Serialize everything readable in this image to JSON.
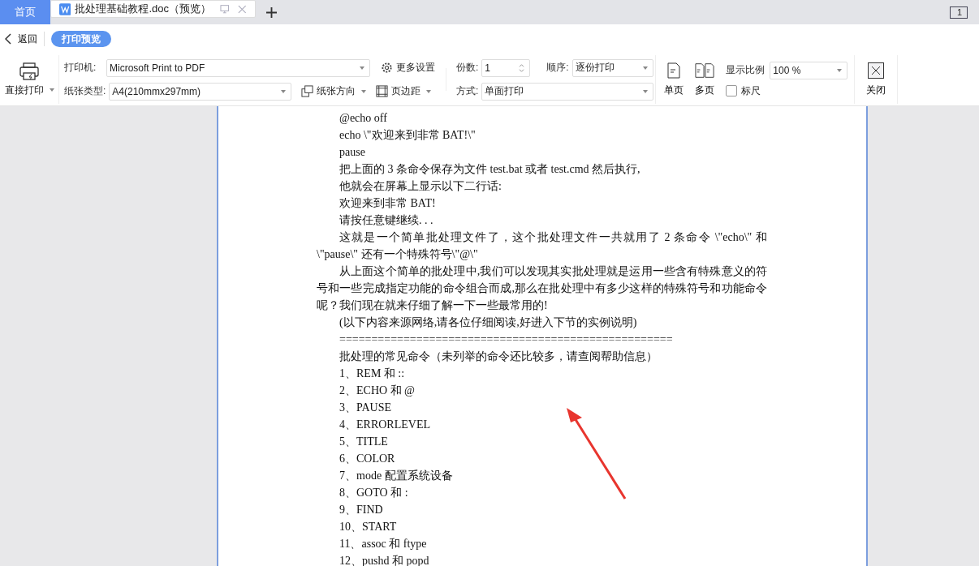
{
  "tabs": [
    {
      "label": "首页",
      "kind": "home",
      "selected": false
    },
    {
      "label": "批处理基础教程.doc（预览）",
      "kind": "doc",
      "selected": true
    }
  ],
  "page_indicator": "1",
  "nav": {
    "back": "返回",
    "mode": "打印预览"
  },
  "toolbar": {
    "direct_print": "直接打印",
    "printer": {
      "label": "打印机:",
      "value": "Microsoft Print to PDF"
    },
    "more_settings": "更多设置",
    "copies": {
      "label": "份数:",
      "value": "1"
    },
    "order": {
      "label": "顺序:",
      "value": "逐份打印"
    },
    "paper": {
      "label": "纸张类型:",
      "value": "A4(210mmx297mm)"
    },
    "orientation": "纸张方向",
    "margins": "页边距",
    "mode": {
      "label": "方式:",
      "value": "单面打印"
    },
    "single_page": "单页",
    "multi_page": "多页",
    "zoom": {
      "label": "显示比例",
      "value": "100 %"
    },
    "ruler": {
      "label": "标尺",
      "checked": false
    },
    "close": "关闭"
  },
  "document": {
    "paragraphs": [
      {
        "kind": "line",
        "text": "@echo off"
      },
      {
        "kind": "line",
        "text": "echo \\\"欢迎来到非常 BAT!\\\""
      },
      {
        "kind": "line",
        "text": "pause"
      },
      {
        "kind": "line",
        "text": "把上面的 3 条命令保存为文件 test.bat 或者 test.cmd 然后执行,"
      },
      {
        "kind": "line",
        "text": "他就会在屏幕上显示以下二行话:"
      },
      {
        "kind": "line",
        "text": "欢迎来到非常 BAT!"
      },
      {
        "kind": "line",
        "text": "请按任意键继续. . ."
      },
      {
        "kind": "para",
        "text": "这就是一个简单批处理文件了，这个批处理文件一共就用了 2 条命令 \\\"echo\\\" 和 \\\"pause\\\" 还有一个特殊符号\\\"@\\\""
      },
      {
        "kind": "para",
        "text": "从上面这个简单的批处理中,我们可以发现其实批处理就是运用一些含有特殊意义的符号和一些完成指定功能的命令组合而成,那么在批处理中有多少这样的特殊符号和功能命令呢？我们现在就来仔细了解一下一些最常用的!"
      },
      {
        "kind": "line",
        "text": "(以下内容来源网络,请各位仔细阅读,好进入下节的实例说明)"
      },
      {
        "kind": "line",
        "text": "===================================================="
      },
      {
        "kind": "line",
        "text": "批处理的常见命令（未列举的命令还比较多，请查阅帮助信息）"
      },
      {
        "kind": "line",
        "text": "1、REM 和 ::"
      },
      {
        "kind": "line",
        "text": "2、ECHO 和 @"
      },
      {
        "kind": "line",
        "text": "3、PAUSE"
      },
      {
        "kind": "line",
        "text": "4、ERRORLEVEL"
      },
      {
        "kind": "line",
        "text": "5、TITLE"
      },
      {
        "kind": "line",
        "text": "6、COLOR"
      },
      {
        "kind": "line",
        "text": "7、mode 配置系统设备"
      },
      {
        "kind": "line",
        "text": "8、GOTO 和 :"
      },
      {
        "kind": "line",
        "text": "9、FIND"
      },
      {
        "kind": "line",
        "text": "10、START"
      },
      {
        "kind": "line",
        "text": "11、assoc 和 ftype"
      },
      {
        "kind": "line",
        "text": "12、pushd 和 popd"
      }
    ]
  }
}
